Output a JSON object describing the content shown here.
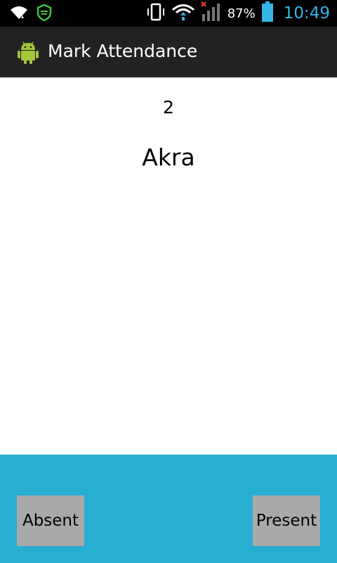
{
  "status_bar": {
    "battery_percent": "87%",
    "time": "10:49",
    "icons": [
      "wifi-signal-icon",
      "shield-icon",
      "vibrate-icon",
      "wifi-data-icon",
      "cell-signal-icon",
      "battery-icon"
    ],
    "clock_color": "#33b5e5"
  },
  "action_bar": {
    "title": "Mark Attendance",
    "icon": "android-icon"
  },
  "student": {
    "number": "2",
    "name": "Akra"
  },
  "actions": {
    "absent_label": "Absent",
    "present_label": "Present"
  },
  "colors": {
    "panel": "#27aed1",
    "button": "#a9a9a9"
  }
}
